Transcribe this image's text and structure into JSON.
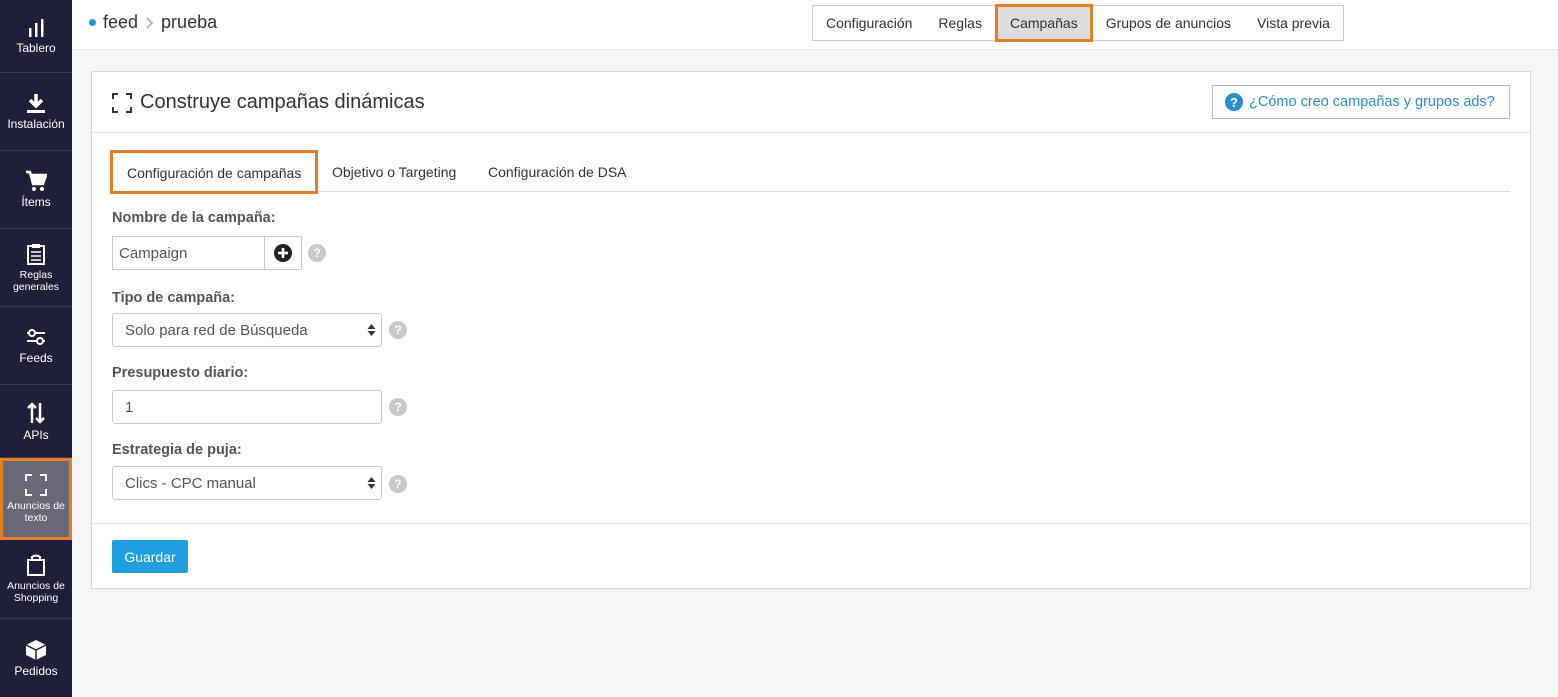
{
  "sidebar": {
    "items": [
      {
        "label": "Tablero",
        "icon": "bar-chart-icon"
      },
      {
        "label": "Instalación",
        "icon": "download-icon"
      },
      {
        "label": "Ítems",
        "icon": "cart-icon"
      },
      {
        "label": "Reglas generales",
        "icon": "clipboard-icon"
      },
      {
        "label": "Feeds",
        "icon": "sliders-icon"
      },
      {
        "label": "APIs",
        "icon": "up-down-arrows-icon"
      },
      {
        "label": "Anuncios de texto",
        "icon": "expand-icon",
        "active": true
      },
      {
        "label": "Anuncios de Shopping",
        "icon": "shopping-bag-icon"
      },
      {
        "label": "Pedidos",
        "icon": "box-icon"
      }
    ]
  },
  "breadcrumb": {
    "feed": "feed",
    "sub": "prueba"
  },
  "steps": [
    "Configuración",
    "Reglas",
    "Campañas",
    "Grupos de anuncios",
    "Vista previa"
  ],
  "panel": {
    "title": "Construye campañas dinámicas",
    "help": "¿Cómo creo campañas y grupos ads?"
  },
  "tabs": [
    "Configuración de campañas",
    "Objetivo o Targeting",
    "Configuración de DSA"
  ],
  "form": {
    "campaign_name_label": "Nombre de la campaña:",
    "campaign_name_value": "Campaign",
    "campaign_type_label": "Tipo de campaña:",
    "campaign_type_value": "Solo para red de Búsqueda",
    "budget_label": "Presupuesto diario:",
    "budget_value": "1",
    "bidding_label": "Estrategia de puja:",
    "bidding_value": "Clics - CPC manual"
  },
  "save_label": "Guardar",
  "colors": {
    "accent": "#e67e22",
    "primary": "#1f9ee0",
    "sidebar": "#1f1f3a"
  }
}
